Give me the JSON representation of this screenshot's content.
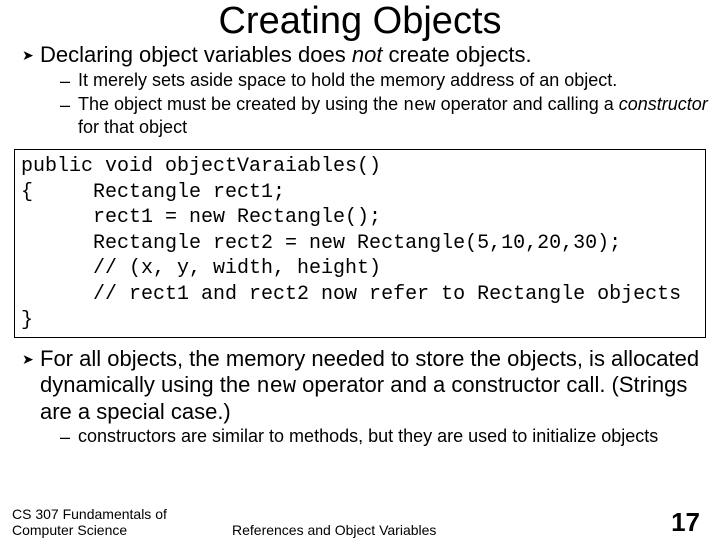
{
  "title": "Creating Objects",
  "bullets": [
    {
      "level": 1,
      "pre": "Declaring object variables does ",
      "em": "not",
      "post": " create objects."
    },
    {
      "level": 2,
      "text": "It merely sets aside space to hold the memory address of an object."
    },
    {
      "level": 2,
      "pre": "The object must be created by using the ",
      "code": "new",
      "mid": " operator and calling a ",
      "em": "constructor",
      "post": " for that object"
    }
  ],
  "code": {
    "l1": "public void objectVaraiables()",
    "l2": "{",
    "l2b": "Rectangle rect1;",
    "l3": "rect1 = new Rectangle();",
    "l4": "Rectangle rect2 = new Rectangle(5,10,20,30);",
    "l5": "// (x, y, width, height)",
    "l6": "// rect1 and rect2 now refer to Rectangle objects",
    "l7": "}"
  },
  "bullets2": [
    {
      "level": 1,
      "pre": "For all objects, the memory needed to store the objects, is allocated dynamically using the ",
      "code": "new",
      "post": " operator and a constructor call. (Strings are a special case.)"
    },
    {
      "level": 2,
      "text": "constructors are similar to methods, but they are used to initialize objects"
    }
  ],
  "footer": {
    "left": "CS 307 Fundamentals of Computer Science",
    "center": "References and Object Variables",
    "page": "17"
  }
}
